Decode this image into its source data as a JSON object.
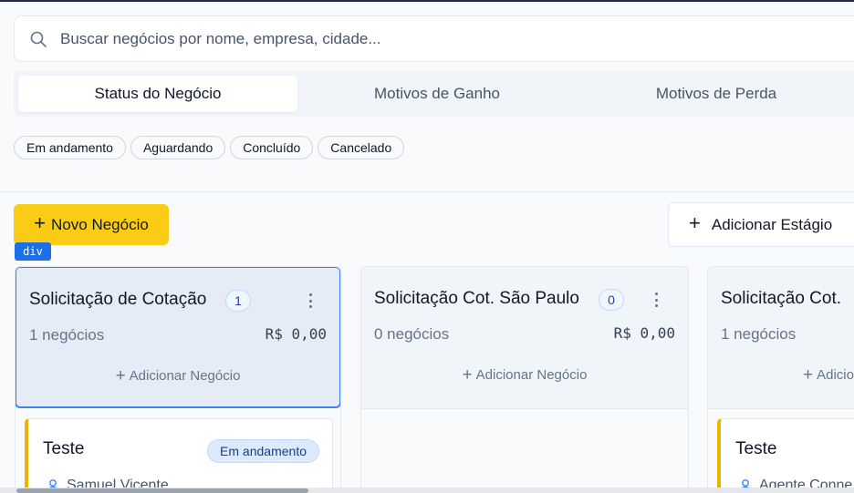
{
  "search": {
    "placeholder": "Buscar negócios por nome, empresa, cidade..."
  },
  "tabs": [
    {
      "label": "Status do Negócio",
      "active": true
    },
    {
      "label": "Motivos de Ganho",
      "active": false
    },
    {
      "label": "Motivos de Perda",
      "active": false
    }
  ],
  "status_chips": [
    "Em andamento",
    "Aguardando",
    "Concluído",
    "Cancelado"
  ],
  "actions": {
    "new_deal": "Novo Negócio",
    "add_stage": "Adicionar Estágio",
    "inspector_tag": "div"
  },
  "columns": [
    {
      "title": "Solicitação de Cotação",
      "count": "1",
      "deals": "1 negócios",
      "total": "R$ 0,00",
      "add_label": "Adicionar Negócio",
      "selected": true,
      "card": {
        "title": "Teste",
        "status": "Em andamento",
        "person": "Samuel Vicente"
      }
    },
    {
      "title": "Solicitação Cot. São Paulo",
      "count": "0",
      "deals": "0 negócios",
      "total": "R$ 0,00",
      "add_label": "Adicionar Negócio",
      "selected": false
    },
    {
      "title": "Solicitação Cot.",
      "count": "",
      "deals": "1 negócios",
      "total": "",
      "add_label": "Adicio",
      "selected": false,
      "card": {
        "title": "Teste",
        "status": "",
        "person": "Agente Conne"
      }
    }
  ],
  "colors": {
    "primary_button": "#facc15",
    "selected_border": "#3b82f6",
    "badge_bg": "#dbeafe",
    "card_accent": "#eab308"
  }
}
